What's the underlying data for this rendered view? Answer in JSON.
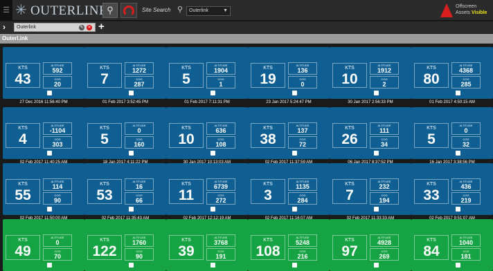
{
  "app": {
    "name": "OUTERLINK",
    "site_search_label": "Site Search",
    "site_select_value": "Outerlink",
    "offscreen_line1": "Offscreen",
    "offscreen_line2_prefix": "Assets",
    "offscreen_line2_value": "Visible"
  },
  "tab": {
    "label": "Outerlink"
  },
  "group": {
    "title": "Outerl.ink"
  },
  "labels": {
    "kts": "KTS",
    "altitude": "ALTITUDE",
    "cog": "COG"
  },
  "colors": {
    "blue_card": "#0f5f93",
    "green_card": "#15a343",
    "alert_red": "#d81e1e",
    "visible_yellow": "#f2e51d"
  },
  "cards": [
    {
      "kts": "43",
      "altitude": "592",
      "cog": "20",
      "timestamp": "27 Dec 2016 11:56:40 PM",
      "color": "blue"
    },
    {
      "kts": "7",
      "altitude": "1272",
      "cog": "287",
      "timestamp": "01 Feb 2017 3:52:45 PM",
      "color": "blue"
    },
    {
      "kts": "5",
      "altitude": "1904",
      "cog": "1",
      "timestamp": "01 Feb 2017 7:11:31 PM",
      "color": "blue"
    },
    {
      "kts": "19",
      "altitude": "136",
      "cog": "0",
      "timestamp": "23 Jan 2017 5:24:47 PM",
      "color": "blue"
    },
    {
      "kts": "10",
      "altitude": "1912",
      "cog": "2",
      "timestamp": "30 Jan 2017 2:56:33 PM",
      "color": "blue"
    },
    {
      "kts": "80",
      "altitude": "4368",
      "cog": "285",
      "timestamp": "01 Feb 2017 4:50:15 AM",
      "color": "blue"
    },
    {
      "kts": "4",
      "altitude": "-1104",
      "cog": "303",
      "timestamp": "02 Feb 2017 11:40:25 AM",
      "color": "blue"
    },
    {
      "kts": "5",
      "altitude": "0",
      "cog": "160",
      "timestamp": "18 Jan 2017 4:11:22 PM",
      "color": "blue"
    },
    {
      "kts": "10",
      "altitude": "636",
      "cog": "108",
      "timestamp": "30 Jan 2017 10:13:03 AM",
      "color": "blue"
    },
    {
      "kts": "38",
      "altitude": "137",
      "cog": "72",
      "timestamp": "02 Feb 2017 11:37:59 AM",
      "color": "blue"
    },
    {
      "kts": "26",
      "altitude": "111",
      "cog": "34",
      "timestamp": "06 Jan 2017 8:37:52 PM",
      "color": "blue"
    },
    {
      "kts": "5",
      "altitude": "0",
      "cog": "32",
      "timestamp": "16 Jan 2017 3:38:56 PM",
      "color": "blue"
    },
    {
      "kts": "55",
      "altitude": "114",
      "cog": "90",
      "timestamp": "02 Feb 2017 11:50:00 AM",
      "color": "blue"
    },
    {
      "kts": "53",
      "altitude": "16",
      "cog": "66",
      "timestamp": "02 Feb 2017 11:35:43 AM",
      "color": "blue"
    },
    {
      "kts": "11",
      "altitude": "6739",
      "cog": "272",
      "timestamp": "02 Feb 2017 12:12:19 AM",
      "color": "blue"
    },
    {
      "kts": "3",
      "altitude": "1135",
      "cog": "284",
      "timestamp": "02 Feb 2017 11:16:07 AM",
      "color": "blue"
    },
    {
      "kts": "7",
      "altitude": "232",
      "cog": "194",
      "timestamp": "02 Feb 2017 11:33:33 AM",
      "color": "blue"
    },
    {
      "kts": "33",
      "altitude": "436",
      "cog": "219",
      "timestamp": "02 Feb 2017 9:51:07 AM",
      "color": "blue"
    },
    {
      "kts": "49",
      "altitude": "0",
      "cog": "70",
      "timestamp": "",
      "color": "green"
    },
    {
      "kts": "122",
      "altitude": "1760",
      "cog": "90",
      "timestamp": "",
      "color": "green"
    },
    {
      "kts": "39",
      "altitude": "3768",
      "cog": "191",
      "timestamp": "",
      "color": "green"
    },
    {
      "kts": "108",
      "altitude": "5248",
      "cog": "216",
      "timestamp": "",
      "color": "green"
    },
    {
      "kts": "97",
      "altitude": "4928",
      "cog": "269",
      "timestamp": "",
      "color": "green"
    },
    {
      "kts": "84",
      "altitude": "1040",
      "cog": "181",
      "timestamp": "",
      "color": "green"
    }
  ]
}
